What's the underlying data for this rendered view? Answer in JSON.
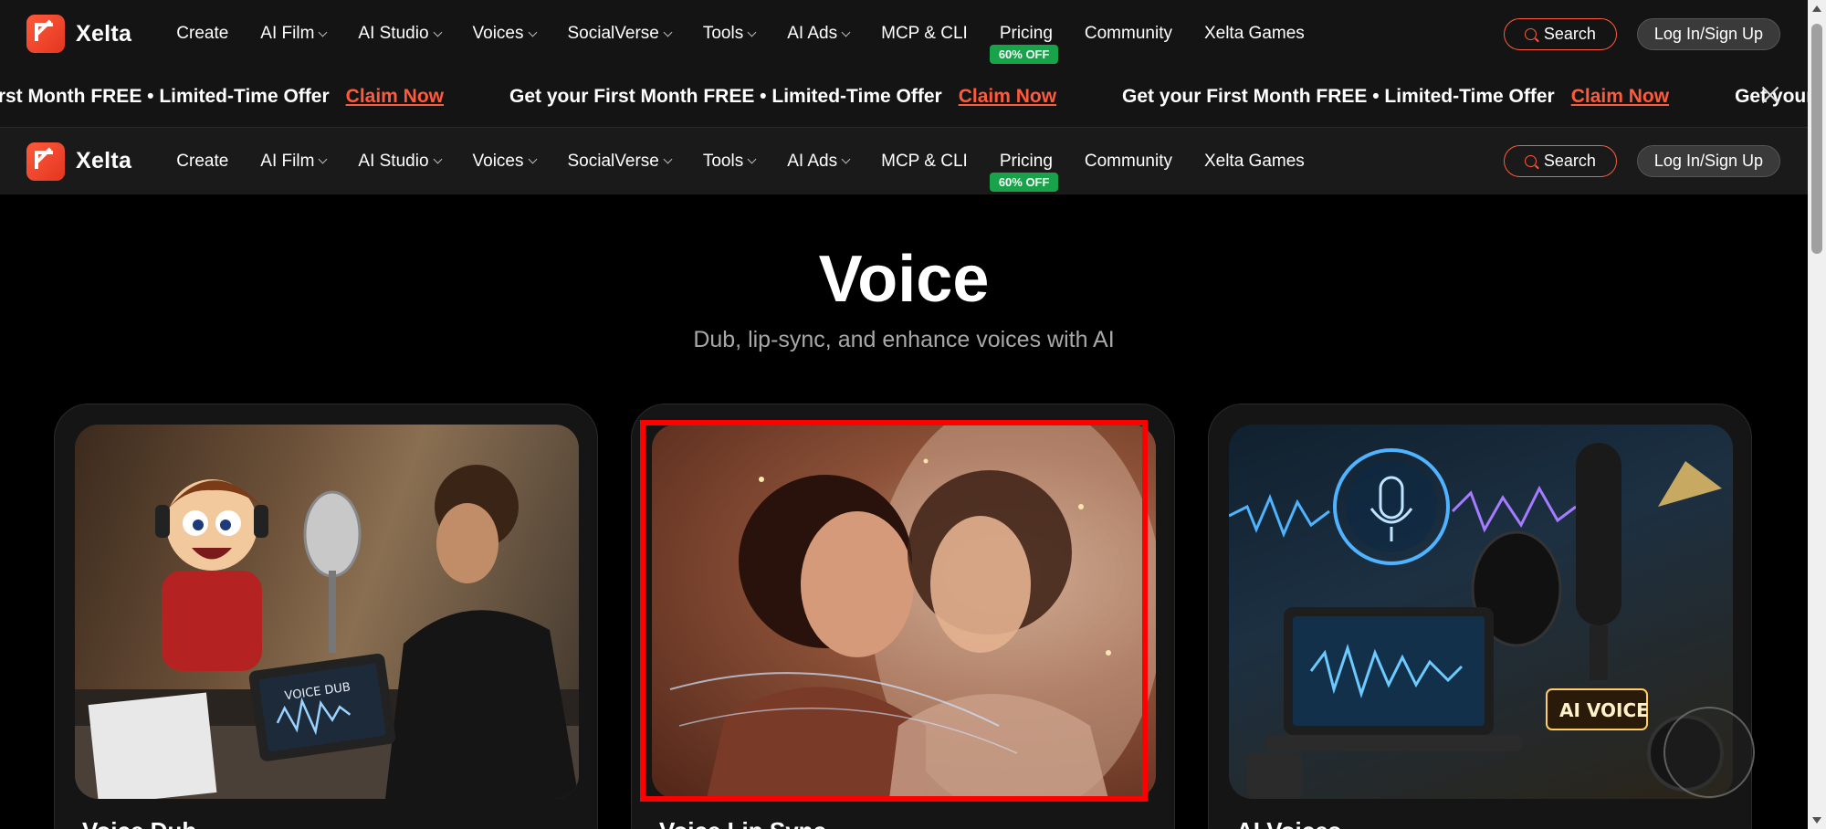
{
  "brand": {
    "name": "Xelta"
  },
  "nav": {
    "items": [
      {
        "label": "Create",
        "dropdown": false
      },
      {
        "label": "AI Film",
        "dropdown": true
      },
      {
        "label": "AI Studio",
        "dropdown": true
      },
      {
        "label": "Voices",
        "dropdown": true
      },
      {
        "label": "SocialVerse",
        "dropdown": true
      },
      {
        "label": "Tools",
        "dropdown": true
      },
      {
        "label": "AI Ads",
        "dropdown": true
      },
      {
        "label": "MCP & CLI",
        "dropdown": false
      },
      {
        "label": "Pricing",
        "dropdown": false,
        "badge": "60% OFF"
      },
      {
        "label": "Community",
        "dropdown": false
      },
      {
        "label": "Xelta Games",
        "dropdown": false
      }
    ],
    "search_label": "Search",
    "login_label": "Log In/Sign Up"
  },
  "banner": {
    "items": [
      {
        "text": "irst Month FREE • Limited-Time Offer",
        "cta": "Claim Now"
      },
      {
        "text": "Get your First Month FREE • Limited-Time Offer",
        "cta": "Claim Now"
      },
      {
        "text": "Get your First Month FREE • Limited-Time Offer",
        "cta": "Claim Now"
      },
      {
        "text": "Get your Fi",
        "cta": ""
      }
    ]
  },
  "hero": {
    "title": "Voice",
    "subtitle": "Dub, lip-sync, and enhance voices with AI"
  },
  "cards": [
    {
      "title": "Voice Dub",
      "image_text": "VOICE DUB"
    },
    {
      "title": "Voice Lip Sync",
      "image_text": ""
    },
    {
      "title": "AI Voices",
      "image_text": "AI VOICE"
    }
  ],
  "colors": {
    "accent": "#ff5a3c",
    "badge": "#18a34a",
    "nav_bg": "#141414",
    "highlight": "#ff0000"
  }
}
